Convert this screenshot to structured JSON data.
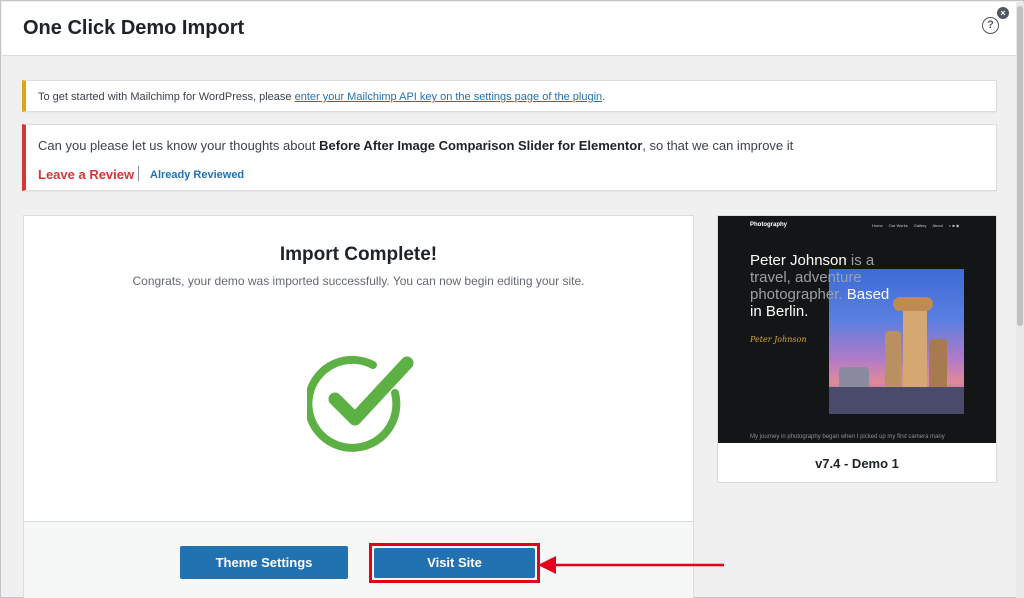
{
  "header": {
    "title": "One Click Demo Import",
    "help_icon": "question-circle-icon",
    "close_icon": "close-circle-icon"
  },
  "notices": {
    "mailchimp": {
      "text": "To get started with Mailchimp for WordPress, please ",
      "link": "enter your Mailchimp API key on the settings page of the plugin",
      "suffix": "."
    },
    "review": {
      "prefix": "Can you please let us know your thoughts about ",
      "plugin": "Before After Image Comparison Slider for Elementor",
      "suffix": ", so that we can improve it",
      "leave_review": "Leave a Review",
      "already_reviewed": "Already Reviewed"
    }
  },
  "import": {
    "title": "Import Complete!",
    "subtitle": "Congrats, your demo was imported successfully. You can now begin editing your site.",
    "status_icon": "check-circle-icon",
    "theme_settings_label": "Theme Settings",
    "visit_site_label": "Visit Site"
  },
  "preview": {
    "logo": "Photography",
    "nav": [
      "Home",
      "Our Works",
      "Gallery",
      "About"
    ],
    "headline_name": "Peter Johnson",
    "headline_rest": " is a travel, adventure photographer.",
    "headline_city": " Based in Berlin.",
    "signature": "Peter Johnson",
    "footer_text": "My journey in photography began when I picked up my first camera many",
    "label": "v7.4 - Demo 1"
  },
  "colors": {
    "accent": "#2271b1",
    "success": "#5cb044",
    "highlight": "#e3001b",
    "warning": "#dba617",
    "error": "#d63638"
  }
}
